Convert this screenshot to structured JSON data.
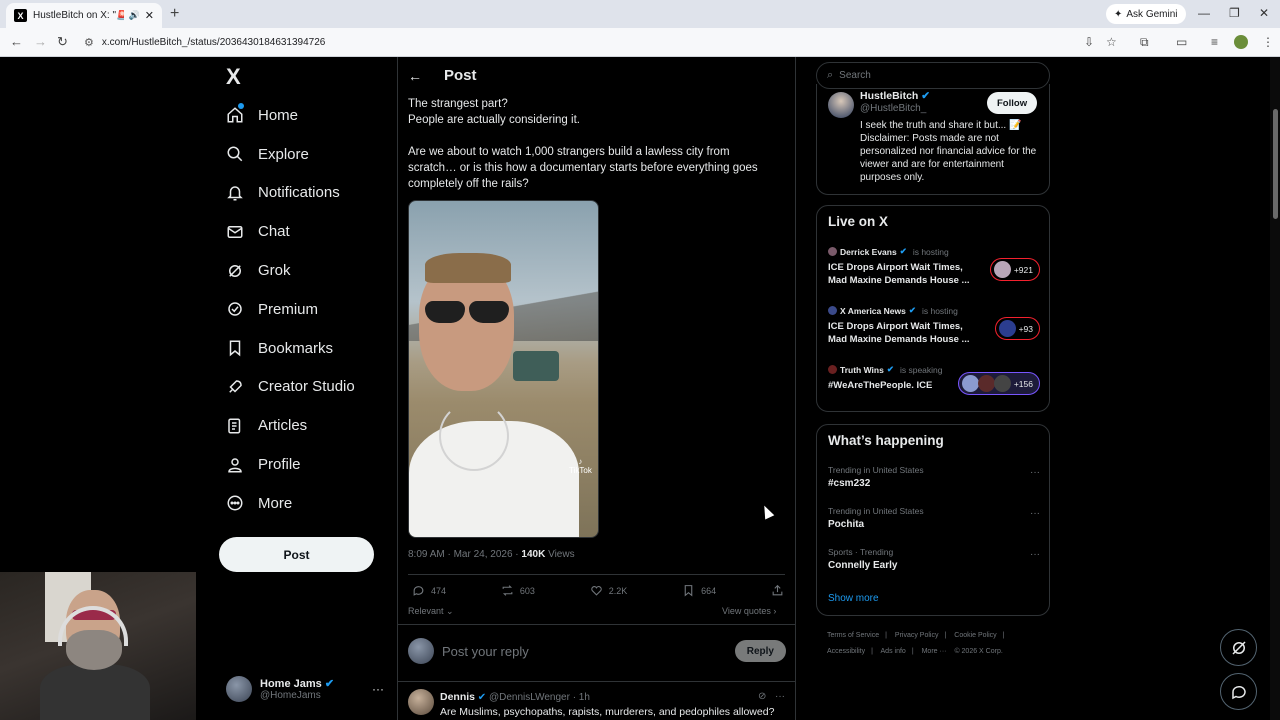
{
  "browser": {
    "tab_title": "HustleBitch on X: \"🚨 \"NO",
    "tab_favicon": "X",
    "url": "x.com/HustleBitch_/status/2036430184631394726",
    "ask_gemini": "Ask Gemini"
  },
  "nav": {
    "logo": "X",
    "items": [
      {
        "label": "Home",
        "icon": "home-icon"
      },
      {
        "label": "Explore",
        "icon": "search-icon"
      },
      {
        "label": "Notifications",
        "icon": "bell-icon"
      },
      {
        "label": "Chat",
        "icon": "mail-icon"
      },
      {
        "label": "Grok",
        "icon": "grok-icon"
      },
      {
        "label": "Premium",
        "icon": "premium-icon"
      },
      {
        "label": "Bookmarks",
        "icon": "bookmark-icon"
      },
      {
        "label": "Creator Studio",
        "icon": "rocket-icon"
      },
      {
        "label": "Articles",
        "icon": "articles-icon"
      },
      {
        "label": "Profile",
        "icon": "person-icon"
      },
      {
        "label": "More",
        "icon": "more-circle-icon"
      }
    ],
    "post_button": "Post",
    "account": {
      "name": "Home Jams",
      "handle": "@HomeJams"
    }
  },
  "post": {
    "header_title": "Post",
    "paragraphs": [
      "The strangest part?\nPeople are actually considering it.",
      "Are we about to watch 1,000 strangers build a lawless city from scratch… or is this how a documentary starts before everything goes completely off the rails?"
    ],
    "media_watermark": "TikTok",
    "timestamp": "8:09 AM · Mar 24, 2026 · ",
    "views_count": "140K",
    "views_label": " Views",
    "actions": {
      "replies": "474",
      "reposts": "603",
      "likes": "2.2K",
      "bookmarks": "664"
    },
    "sort_label": "Relevant",
    "view_quotes": "View quotes",
    "reply_placeholder": "Post your reply",
    "reply_button": "Reply"
  },
  "reply": {
    "name": "Dennis",
    "handle": "@DennisLWenger",
    "time": "· 1h",
    "text": "Are Muslims, psychopaths, rapists, murderers, and pedophiles allowed?"
  },
  "sidebar": {
    "search_placeholder": "Search",
    "profile": {
      "name": "HustleBitch",
      "handle": "@HustleBitch_",
      "follow": "Follow",
      "bio": "I seek the truth and share it but... 📝 Disclaimer: Posts made are not personalized nor financial advice for the viewer and are for entertainment purposes only."
    },
    "live_title": "Live on X",
    "live": [
      {
        "host": "Derrick Evans",
        "status": "is hosting",
        "title": "ICE Drops Airport Wait Times, Mad Maxine Demands House ...",
        "count": "+921"
      },
      {
        "host": "X America News",
        "status": "is hosting",
        "title": "ICE Drops Airport Wait Times, Mad Maxine Demands House ...",
        "count": "+93"
      },
      {
        "host": "Truth Wins",
        "status": "is speaking",
        "title": "#WeAreThePeople. ICE",
        "count": "+156"
      }
    ],
    "happening_title": "What’s happening",
    "trends": [
      {
        "context": "Trending in United States",
        "title": "#csm232"
      },
      {
        "context": "Trending in United States",
        "title": "Pochita"
      },
      {
        "context": "Sports · Trending",
        "title": "Connelly Early"
      }
    ],
    "show_more": "Show more",
    "footer": [
      "Terms of Service",
      "|",
      "Privacy Policy",
      "|",
      "Cookie Policy",
      "|",
      "Accessibility",
      "|",
      "Ads info",
      "|",
      "More ···",
      "© 2026 X Corp."
    ]
  },
  "colors": {
    "accent": "#1d9bf0",
    "background": "#000000",
    "live_red": "#f4212e",
    "live_purple": "#7856ff"
  }
}
